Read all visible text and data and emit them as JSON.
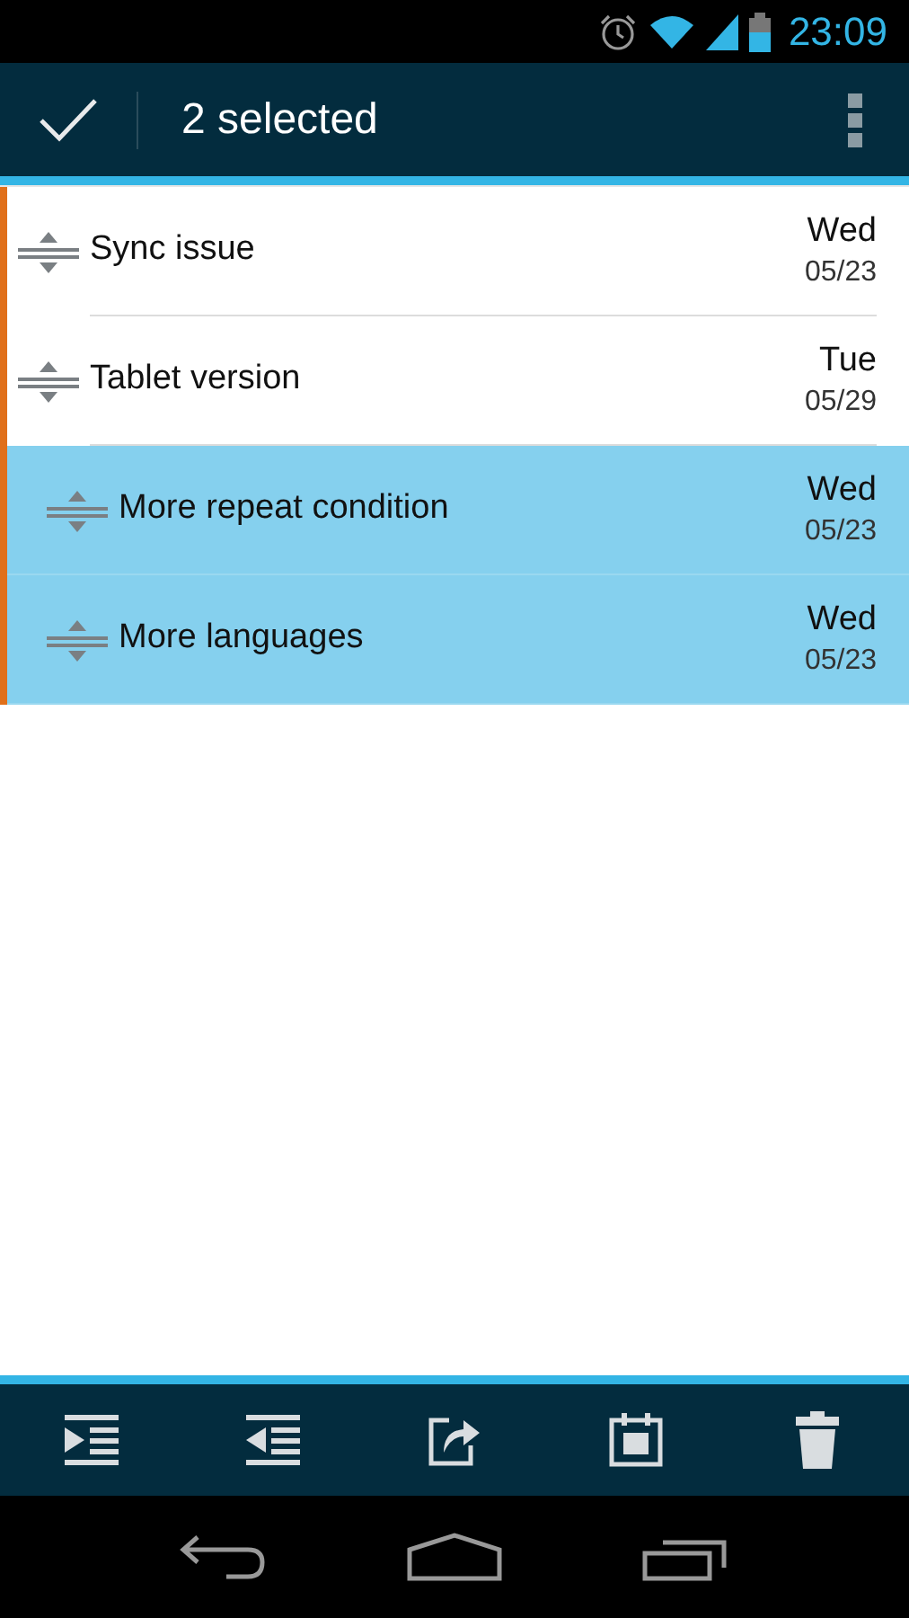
{
  "status_bar": {
    "time": "23:09"
  },
  "action_bar": {
    "title": "2 selected"
  },
  "tasks": [
    {
      "title": "Sync issue",
      "day": "Wed",
      "date": "05/23",
      "selected": false
    },
    {
      "title": "Tablet version",
      "day": "Tue",
      "date": "05/29",
      "selected": false,
      "children": [
        {
          "title": "More repeat condition",
          "day": "Wed",
          "date": "05/23",
          "selected": true
        },
        {
          "title": "More languages",
          "day": "Wed",
          "date": "05/23",
          "selected": true
        }
      ]
    }
  ]
}
